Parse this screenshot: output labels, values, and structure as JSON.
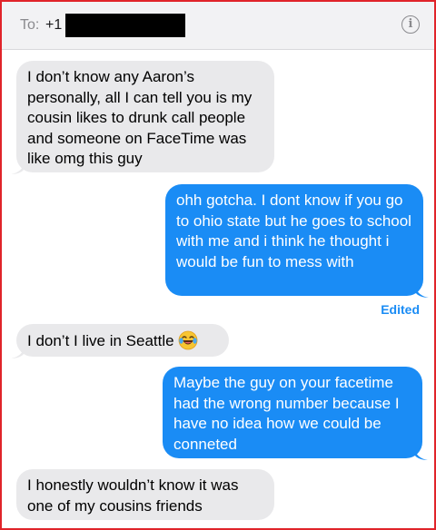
{
  "header": {
    "to_label": "To:",
    "number_prefix": "+1",
    "info_icon": "info-circle-icon"
  },
  "messages": [
    {
      "direction": "incoming",
      "text": "I don’t know any Aaron’s personally, all I can tell you is my cousin likes to drunk call people and someone on FaceTime was like omg this guy"
    },
    {
      "direction": "outgoing",
      "text": "ohh gotcha. I dont know if you go to ohio state but he goes to school with me and i think he thought i would be fun to mess with"
    },
    {
      "direction": "incoming",
      "text": "I don’t I live in Seattle",
      "emoji": "laughing-crying-emoji"
    },
    {
      "direction": "outgoing",
      "text": "Maybe the guy on your facetime had the wrong number because I have no idea how we could be conneted"
    },
    {
      "direction": "incoming",
      "text": "I honestly wouldn’t know it was one of my cousins friends"
    }
  ],
  "edited_label": "Edited",
  "colors": {
    "incoming_bubble": "#e9e9eb",
    "outgoing_bubble": "#1a8cf5",
    "edited_text": "#1a8cf5",
    "frame_border": "#e0242a"
  }
}
